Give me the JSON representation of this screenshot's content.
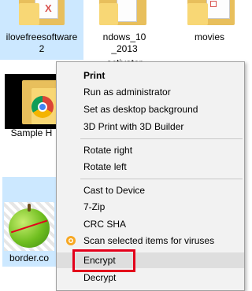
{
  "files": [
    {
      "label": "ilovefreesoftware\n2",
      "kind": "folder",
      "selected": true
    },
    {
      "label": "ndows_10\n_2013",
      "kind": "folder"
    },
    {
      "label": "movies",
      "kind": "folder"
    },
    {
      "label": "activator",
      "kind": "folder"
    },
    {
      "label": "Sample H",
      "kind": "folder"
    },
    {
      "label": "border.co",
      "kind": "image",
      "selected": true
    }
  ],
  "context_menu": {
    "items": [
      {
        "label": "Print",
        "bold": true
      },
      {
        "label": "Run as administrator"
      },
      {
        "label": "Set as desktop background"
      },
      {
        "label": "3D Print with 3D Builder"
      },
      {
        "label": "Rotate right"
      },
      {
        "label": "Rotate left"
      },
      {
        "label": "Cast to Device"
      },
      {
        "label": "7-Zip"
      },
      {
        "label": "CRC SHA"
      },
      {
        "label": "Scan selected items for viruses",
        "icon": "antivirus-icon"
      },
      {
        "label": "Encrypt",
        "highlighted": true
      },
      {
        "label": "Decrypt"
      }
    ]
  },
  "colors": {
    "selection": "#cce8ff",
    "menu_background": "#f2f2f2",
    "highlight_box": "#e3001b",
    "folder": "#f8d775"
  }
}
